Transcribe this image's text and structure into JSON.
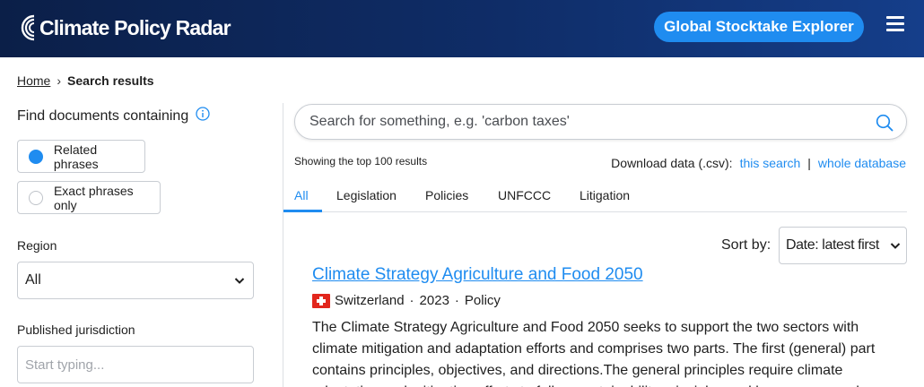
{
  "header": {
    "logo_text": "Climate Policy Radar",
    "cta_label": "Global Stocktake Explorer",
    "brand_color": "#1f8cf0",
    "icons": [
      "radar-logo-icon",
      "hamburger-menu-icon"
    ]
  },
  "breadcrumb": {
    "home": "Home",
    "separator": "›",
    "current": "Search results"
  },
  "sidebar": {
    "find_title": "Find documents containing",
    "options": [
      {
        "label": "Related phrases",
        "selected": true
      },
      {
        "label": "Exact phrases only",
        "selected": false
      }
    ],
    "region_label": "Region",
    "region_value": "All",
    "jurisdiction_label": "Published jurisdiction",
    "jurisdiction_placeholder": "Start typing..."
  },
  "search": {
    "placeholder": "Search for something, e.g. 'carbon taxes'",
    "value": ""
  },
  "results_info": {
    "showing": "Showing the top 100 results",
    "download_label": "Download data (.csv):",
    "this_search": "this search",
    "separator": "|",
    "whole_database": "whole database"
  },
  "tabs": [
    {
      "label": "All",
      "active": true
    },
    {
      "label": "Legislation",
      "active": false
    },
    {
      "label": "Policies",
      "active": false
    },
    {
      "label": "UNFCCC",
      "active": false
    },
    {
      "label": "Litigation",
      "active": false
    }
  ],
  "sort": {
    "label": "Sort by:",
    "value": "Date: latest first"
  },
  "results": [
    {
      "title": "Climate Strategy Agriculture and Food 2050",
      "country": "Switzerland",
      "year": "2023",
      "type": "Policy",
      "meta_separator": "·",
      "flag": "switzerland-flag",
      "summary": "The Climate Strategy Agriculture and Food 2050 seeks to support the two sectors with climate mitigation and adaptation efforts and comprises two parts. The first (general) part contains principles, objectives, and directions.The general principles require climate adaptation and mitigation efforts to follow sustainability principles and be resource and"
    }
  ]
}
